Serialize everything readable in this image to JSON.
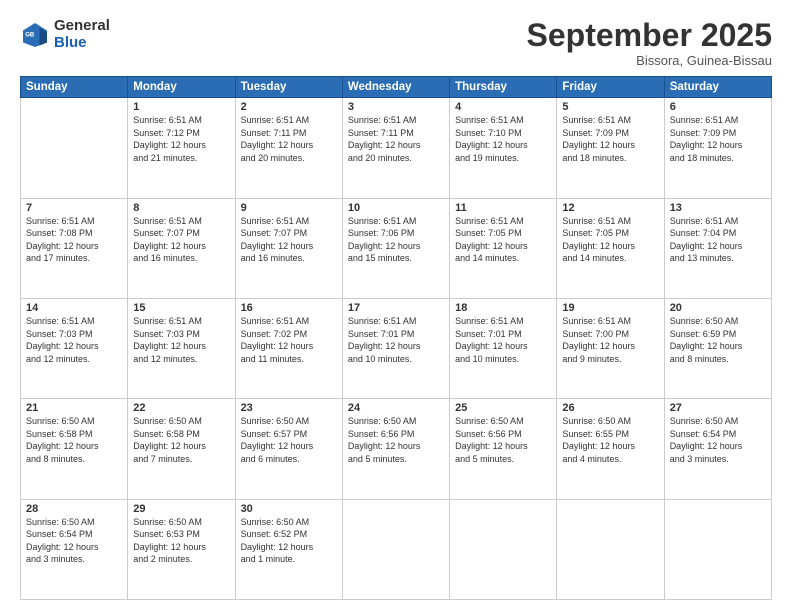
{
  "logo": {
    "general": "General",
    "blue": "Blue"
  },
  "header": {
    "month": "September 2025",
    "location": "Bissora, Guinea-Bissau"
  },
  "weekdays": [
    "Sunday",
    "Monday",
    "Tuesday",
    "Wednesday",
    "Thursday",
    "Friday",
    "Saturday"
  ],
  "weeks": [
    [
      {
        "num": "",
        "info": ""
      },
      {
        "num": "1",
        "info": "Sunrise: 6:51 AM\nSunset: 7:12 PM\nDaylight: 12 hours\nand 21 minutes."
      },
      {
        "num": "2",
        "info": "Sunrise: 6:51 AM\nSunset: 7:11 PM\nDaylight: 12 hours\nand 20 minutes."
      },
      {
        "num": "3",
        "info": "Sunrise: 6:51 AM\nSunset: 7:11 PM\nDaylight: 12 hours\nand 20 minutes."
      },
      {
        "num": "4",
        "info": "Sunrise: 6:51 AM\nSunset: 7:10 PM\nDaylight: 12 hours\nand 19 minutes."
      },
      {
        "num": "5",
        "info": "Sunrise: 6:51 AM\nSunset: 7:09 PM\nDaylight: 12 hours\nand 18 minutes."
      },
      {
        "num": "6",
        "info": "Sunrise: 6:51 AM\nSunset: 7:09 PM\nDaylight: 12 hours\nand 18 minutes."
      }
    ],
    [
      {
        "num": "7",
        "info": "Sunrise: 6:51 AM\nSunset: 7:08 PM\nDaylight: 12 hours\nand 17 minutes."
      },
      {
        "num": "8",
        "info": "Sunrise: 6:51 AM\nSunset: 7:07 PM\nDaylight: 12 hours\nand 16 minutes."
      },
      {
        "num": "9",
        "info": "Sunrise: 6:51 AM\nSunset: 7:07 PM\nDaylight: 12 hours\nand 16 minutes."
      },
      {
        "num": "10",
        "info": "Sunrise: 6:51 AM\nSunset: 7:06 PM\nDaylight: 12 hours\nand 15 minutes."
      },
      {
        "num": "11",
        "info": "Sunrise: 6:51 AM\nSunset: 7:05 PM\nDaylight: 12 hours\nand 14 minutes."
      },
      {
        "num": "12",
        "info": "Sunrise: 6:51 AM\nSunset: 7:05 PM\nDaylight: 12 hours\nand 14 minutes."
      },
      {
        "num": "13",
        "info": "Sunrise: 6:51 AM\nSunset: 7:04 PM\nDaylight: 12 hours\nand 13 minutes."
      }
    ],
    [
      {
        "num": "14",
        "info": "Sunrise: 6:51 AM\nSunset: 7:03 PM\nDaylight: 12 hours\nand 12 minutes."
      },
      {
        "num": "15",
        "info": "Sunrise: 6:51 AM\nSunset: 7:03 PM\nDaylight: 12 hours\nand 12 minutes."
      },
      {
        "num": "16",
        "info": "Sunrise: 6:51 AM\nSunset: 7:02 PM\nDaylight: 12 hours\nand 11 minutes."
      },
      {
        "num": "17",
        "info": "Sunrise: 6:51 AM\nSunset: 7:01 PM\nDaylight: 12 hours\nand 10 minutes."
      },
      {
        "num": "18",
        "info": "Sunrise: 6:51 AM\nSunset: 7:01 PM\nDaylight: 12 hours\nand 10 minutes."
      },
      {
        "num": "19",
        "info": "Sunrise: 6:51 AM\nSunset: 7:00 PM\nDaylight: 12 hours\nand 9 minutes."
      },
      {
        "num": "20",
        "info": "Sunrise: 6:50 AM\nSunset: 6:59 PM\nDaylight: 12 hours\nand 8 minutes."
      }
    ],
    [
      {
        "num": "21",
        "info": "Sunrise: 6:50 AM\nSunset: 6:58 PM\nDaylight: 12 hours\nand 8 minutes."
      },
      {
        "num": "22",
        "info": "Sunrise: 6:50 AM\nSunset: 6:58 PM\nDaylight: 12 hours\nand 7 minutes."
      },
      {
        "num": "23",
        "info": "Sunrise: 6:50 AM\nSunset: 6:57 PM\nDaylight: 12 hours\nand 6 minutes."
      },
      {
        "num": "24",
        "info": "Sunrise: 6:50 AM\nSunset: 6:56 PM\nDaylight: 12 hours\nand 5 minutes."
      },
      {
        "num": "25",
        "info": "Sunrise: 6:50 AM\nSunset: 6:56 PM\nDaylight: 12 hours\nand 5 minutes."
      },
      {
        "num": "26",
        "info": "Sunrise: 6:50 AM\nSunset: 6:55 PM\nDaylight: 12 hours\nand 4 minutes."
      },
      {
        "num": "27",
        "info": "Sunrise: 6:50 AM\nSunset: 6:54 PM\nDaylight: 12 hours\nand 3 minutes."
      }
    ],
    [
      {
        "num": "28",
        "info": "Sunrise: 6:50 AM\nSunset: 6:54 PM\nDaylight: 12 hours\nand 3 minutes."
      },
      {
        "num": "29",
        "info": "Sunrise: 6:50 AM\nSunset: 6:53 PM\nDaylight: 12 hours\nand 2 minutes."
      },
      {
        "num": "30",
        "info": "Sunrise: 6:50 AM\nSunset: 6:52 PM\nDaylight: 12 hours\nand 1 minute."
      },
      {
        "num": "",
        "info": ""
      },
      {
        "num": "",
        "info": ""
      },
      {
        "num": "",
        "info": ""
      },
      {
        "num": "",
        "info": ""
      }
    ]
  ]
}
